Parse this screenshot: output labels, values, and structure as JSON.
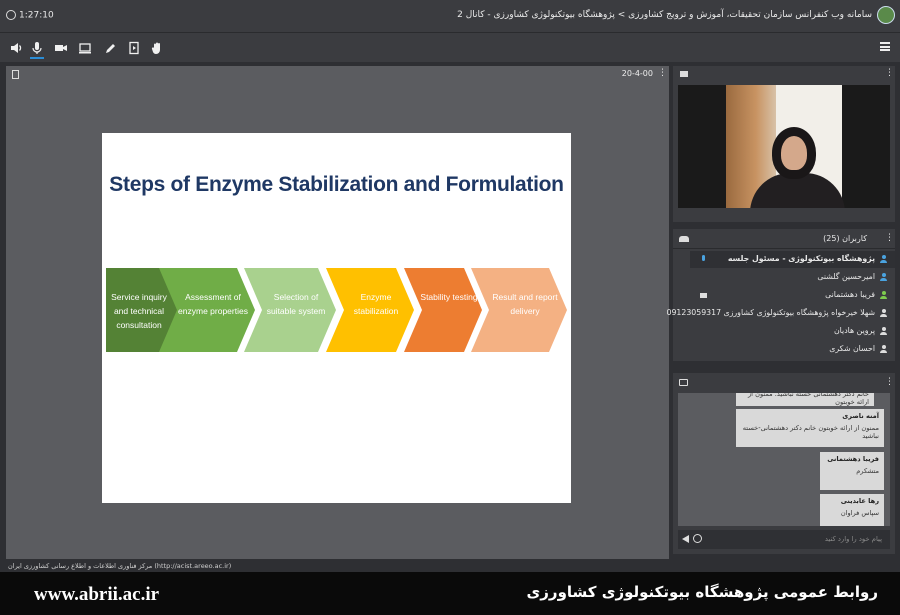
{
  "topbar": {
    "timer": "1:27:10",
    "title": "سامانه وب کنفرانس سازمان تحقیقات، آموزش و ترویج کشاورزی > پژوهشگاه بیوتکنولوژی کشاورزی - کانال 2"
  },
  "toolbar": {
    "icons": [
      "speaker-icon",
      "microphone-icon",
      "camera-icon",
      "screen-share-icon",
      "pen-icon",
      "presentation-icon",
      "raise-hand-icon",
      "menu-icon"
    ]
  },
  "presentation": {
    "page_label": "20-4-00",
    "slide": {
      "title": "Steps of Enzyme Stabilization and Formulation",
      "steps": [
        {
          "label": "Service inquiry and technical consultation",
          "color": "#548235"
        },
        {
          "label": "Assessment of enzyme properties",
          "color": "#70ad47"
        },
        {
          "label": "Selection of suitable system",
          "color": "#a9d18e"
        },
        {
          "label": "Enzyme stabilization",
          "color": "#ffc000"
        },
        {
          "label": "Stability testing",
          "color": "#ed7d31"
        },
        {
          "label": "Result and report delivery",
          "color": "#f4b183"
        }
      ]
    }
  },
  "users": {
    "title": "کاربران (25)",
    "list": [
      {
        "name": "پژوهشگاه بیوتکنولوژی - مسئول جلسه",
        "role": "host",
        "icon_color": "#4aa3e0",
        "indicator": "mic",
        "indicator_color": "#4aa3e0"
      },
      {
        "name": "امیرحسین گلشنی",
        "icon_color": "#4aa3e0"
      },
      {
        "name": "فریبا دهشتمانی",
        "icon_color": "#7ecb4e",
        "indicator": "camera",
        "indicator_color": "#dddddd"
      },
      {
        "name": "شهلا خیرخواه پژوهشگاه بیوتکنولوژی کشاورزی 09123059317",
        "icon_color": "#dddddd"
      },
      {
        "name": "پروین هادیان",
        "icon_color": "#dddddd"
      },
      {
        "name": "احسان شکری",
        "icon_color": "#dddddd"
      }
    ]
  },
  "chat": {
    "messages": [
      {
        "sender": "",
        "text": "خانم دکتر دهشتمانی خسته نباشید. ممنون از ارائه خوبتون"
      },
      {
        "sender": "آمنه ناصری",
        "text": "ممنون از ارائه خوبتون خانم دکتر دهشتمانی-خسته نباشید"
      },
      {
        "sender": "فریبا دهشتمانی",
        "text": "متشکرم"
      },
      {
        "sender": "رها عابدینی",
        "text": "سپاس فراوان"
      }
    ],
    "placeholder": "پیام خود را وارد کنید"
  },
  "footer": {
    "caption": "مرکز فناوری اطلاعات و اطلاع رسانی کشاورزی ایران (http://acist.areeo.ac.ir)"
  },
  "banner": {
    "site": "www.abrii.ac.ir",
    "org": "روابط عمومی پژوهشگاه بیوتکنولوژی کشاورزی"
  }
}
